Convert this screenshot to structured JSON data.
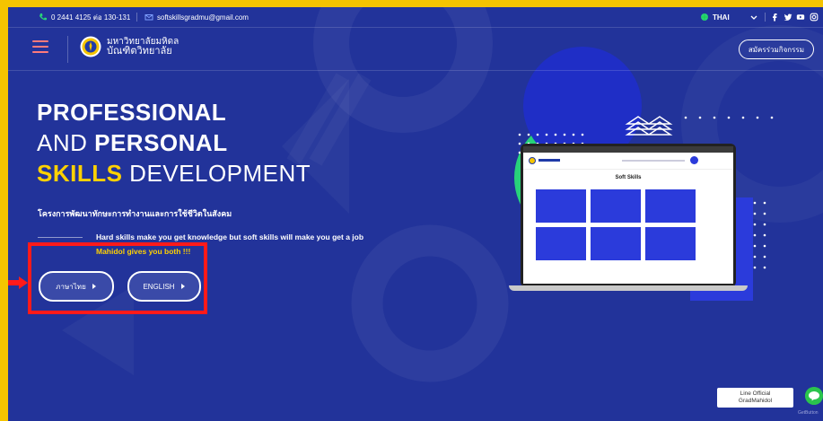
{
  "topbar": {
    "phone": "0 2441 4125 ต่อ 130-131",
    "email": "softskillsgradmu@gmail.com",
    "language": "THAI"
  },
  "header": {
    "logo_line1": "มหาวิทยาลัยมหิดล",
    "logo_line2": "บัณฑิตวิทยาลัย",
    "signup_label": "สมัครร่วมกิจกรรม"
  },
  "hero": {
    "line1": "PROFESSIONAL",
    "line2_plain": "AND ",
    "line2_bold": "PERSONAL",
    "line3_highlight": "SKILLS",
    "line3_plain": " DEVELOPMENT",
    "subtitle": "โครงการพัฒนาทักษะการทำงานและการใช้ชีวิตในสังคม",
    "desc1": "Hard skills make you get knowledge but soft skills will make you get a job",
    "desc2": "Mahidol gives you both !!!",
    "btn_thai": "ภาษาไทย",
    "btn_english": "ENGLISH"
  },
  "laptop_screen": {
    "title": "Soft Skills"
  },
  "line_badge": {
    "line1": "Line Official",
    "line2": "GradMahidol"
  },
  "getbutton": "GetButton",
  "colors": {
    "background": "#22339a",
    "accent_yellow": "#ffd100",
    "frame_yellow": "#f5c400",
    "annotation_red": "#ff1a1a",
    "line_green": "#2bc44d"
  },
  "icons": [
    "phone-icon",
    "mail-icon",
    "globe-icon",
    "chevron-down-icon",
    "facebook-icon",
    "twitter-icon",
    "youtube-icon",
    "instagram-icon",
    "hamburger-menu-icon",
    "university-seal-icon",
    "play-arrow-icon",
    "line-chat-icon"
  ]
}
